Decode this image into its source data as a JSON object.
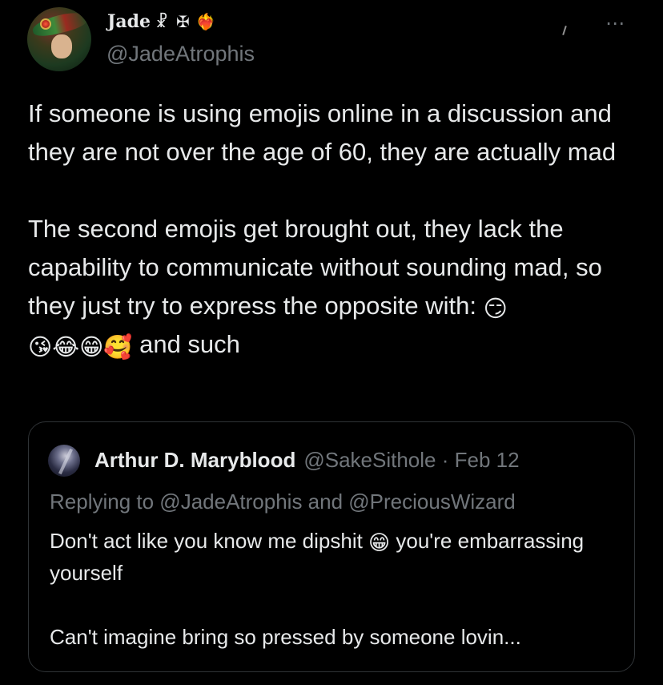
{
  "author": {
    "display_name": "Jade",
    "name_glyphs": "☧ ✠",
    "name_emoji": "❤️‍🔥",
    "handle": "@JadeAtrophis",
    "more_icon": "⋯"
  },
  "tweet": {
    "paragraph1": "If someone is using emojis online in a discussion and they are not over the age of 60, they are actually mad",
    "paragraph2_text": "The second emojis get brought out, they lack the capability to communicate without sounding mad, so they just try to express the opposite with: ",
    "emojis": {
      "smirk": "😏",
      "kiss": "😘",
      "joy": "😂",
      "grin": "😁",
      "love": "🥰"
    },
    "paragraph2_tail": " and such"
  },
  "quote": {
    "name": "Arthur D. Maryblood",
    "handle_date": "@SakeSithole · Feb 12",
    "replying": "Replying to @JadeAtrophis and @PreciousWizard",
    "text_line1": "Don't act like you know me dipshit ",
    "emoji": "😁",
    "text_line1_tail": " you're embarrassing yourself",
    "text_line2": "Can't imagine bring so pressed by someone lovin..."
  }
}
